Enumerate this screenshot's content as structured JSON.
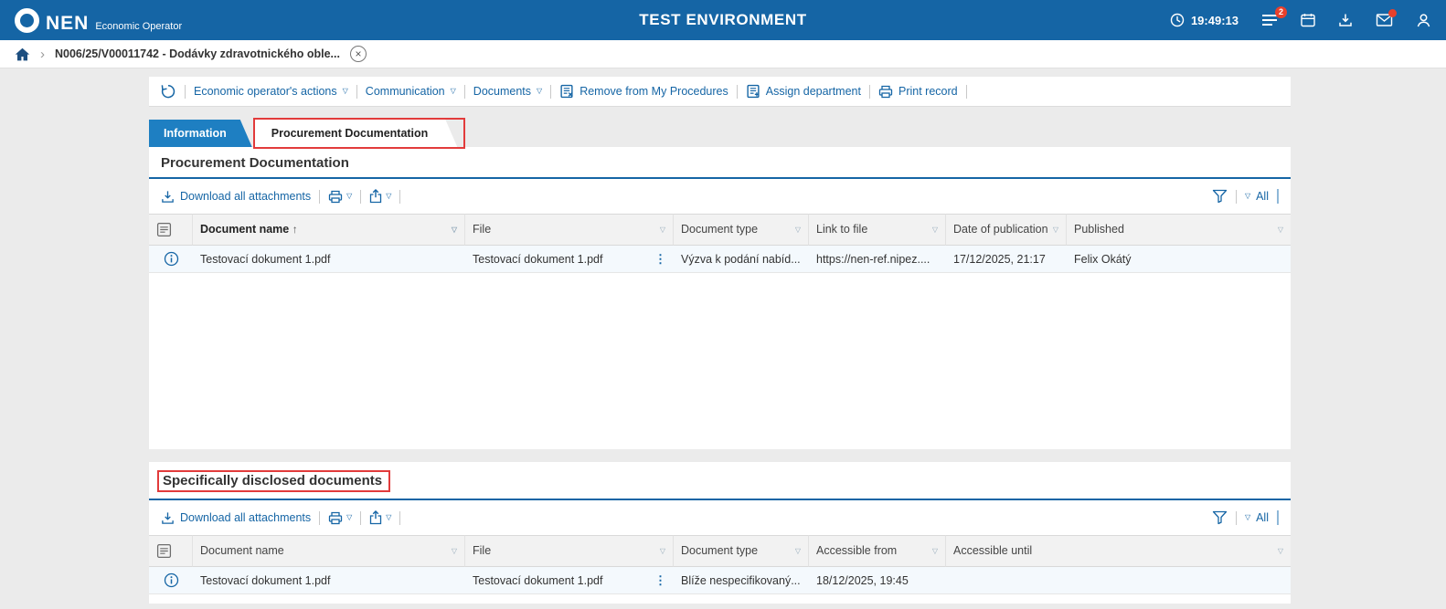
{
  "colors": {
    "header_bg": "#1565a5",
    "link_blue": "#1565a5",
    "active_tab_bg": "#1e7fc2",
    "annotation_red": "#e23b3b",
    "badge_red": "#e8402c"
  },
  "icons": {
    "dropdown": "▽",
    "chevron": "›",
    "close": "×",
    "dots_menu": "⋮"
  },
  "header": {
    "logo": "NEN",
    "logo_subtitle": "Economic Operator",
    "title": "TEST ENVIRONMENT",
    "clock": "19:49:13",
    "menu_badge": "2"
  },
  "breadcrumb": {
    "item": "N006/25/V00011742 - Dodávky zdravotnického oble..."
  },
  "toolbar": {
    "items": [
      {
        "label": "Economic operator's actions"
      },
      {
        "label": "Communication"
      },
      {
        "label": "Documents"
      },
      {
        "label": "Remove from My Procedures"
      },
      {
        "label": "Assign department"
      },
      {
        "label": "Print record"
      }
    ]
  },
  "tabs": [
    {
      "label": "Information"
    },
    {
      "label": "Procurement Documentation"
    }
  ],
  "sections": [
    {
      "title": "Procurement Documentation",
      "toolbar": {
        "download_all": "Download all attachments",
        "all": "All"
      },
      "table": {
        "columns": [
          {
            "label": "Document name",
            "sort": "↑"
          },
          {
            "label": "File"
          },
          {
            "label": "Document type"
          },
          {
            "label": "Link to file"
          },
          {
            "label": "Date of publication"
          },
          {
            "label": "Published"
          }
        ],
        "rows": [
          {
            "document_name": "Testovací dokument 1.pdf",
            "file": "Testovací dokument 1.pdf",
            "document_type": "Výzva k podání nabíd...",
            "link_to_file": "https://nen-ref.nipez....",
            "date_of_publication": "17/12/2025, 21:17",
            "published": "Felix Okátý"
          }
        ]
      }
    },
    {
      "title": "Specifically disclosed documents",
      "toolbar": {
        "download_all": "Download all attachments",
        "all": "All"
      },
      "table": {
        "columns": [
          {
            "label": "Document name"
          },
          {
            "label": "File"
          },
          {
            "label": "Document type"
          },
          {
            "label": "Accessible from"
          },
          {
            "label": "Accessible until"
          }
        ],
        "rows": [
          {
            "document_name": "Testovací dokument 1.pdf",
            "file": "Testovací dokument 1.pdf",
            "document_type": "Blíže nespecifikovaný...",
            "accessible_from": "18/12/2025, 19:45",
            "accessible_until": ""
          }
        ]
      }
    }
  ]
}
